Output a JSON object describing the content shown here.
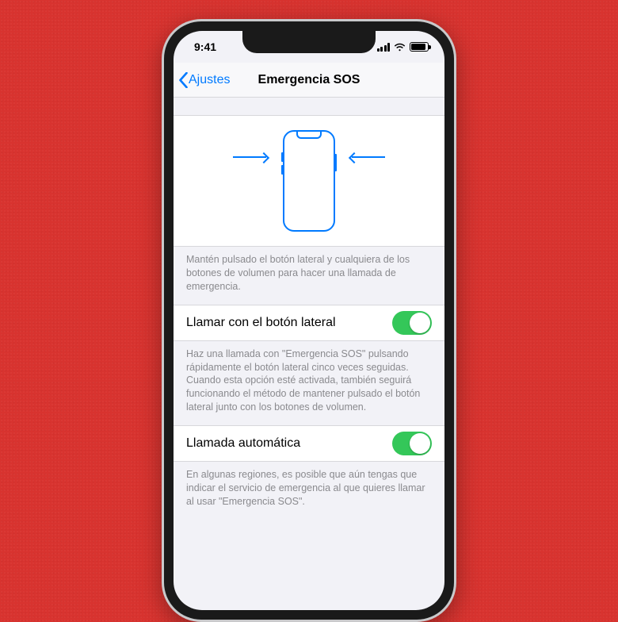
{
  "status": {
    "time": "9:41"
  },
  "nav": {
    "back_label": "Ajustes",
    "title": "Emergencia SOS"
  },
  "illustration": {
    "description": "Mantén pulsado el botón lateral y cualquiera de los botones de volumen para hacer una llamada de emergencia."
  },
  "settings": [
    {
      "label": "Llamar con el botón lateral",
      "enabled": true,
      "footer": "Haz una llamada con \"Emergencia SOS\" pulsando rápidamente el botón lateral cinco veces seguidas. Cuando esta opción esté activada, también seguirá funcionando el método de mantener pulsado el botón lateral junto con los botones de volumen."
    },
    {
      "label": "Llamada automática",
      "enabled": true,
      "footer": "En algunas regiones, es posible que aún tengas que indicar el servicio de emergencia al que quieres llamar al usar \"Emergencia SOS\"."
    }
  ]
}
